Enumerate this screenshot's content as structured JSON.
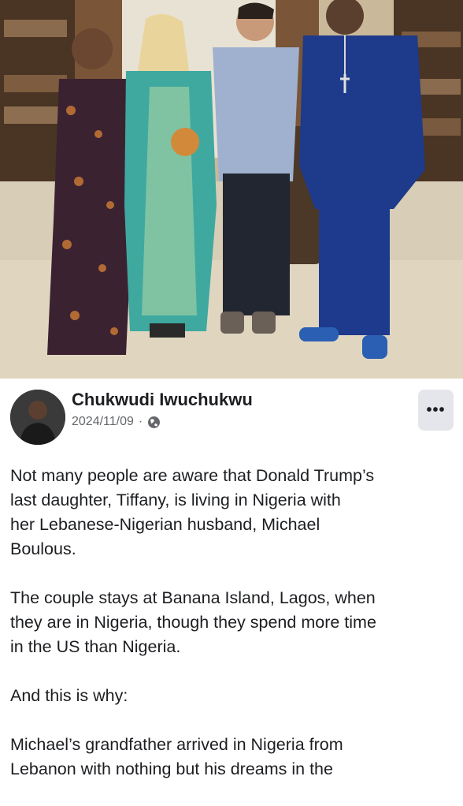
{
  "post": {
    "author": "Chukwudi Iwuchukwu",
    "date": "2024/11/09",
    "separator": "·",
    "privacy_icon": "globe-icon",
    "more_icon": "more-options-icon",
    "more_label": "•••"
  },
  "content": {
    "p1_l1": "Not many people are aware that Donald Trump’s",
    "p1_l2": "last daughter, Tiffany, is living in Nigeria with",
    "p1_l3": "her Lebanese-Nigerian husband, Michael",
    "p1_l4": "Boulous.",
    "p2_l1": "The couple stays at Banana Island, Lagos, when",
    "p2_l2": "they are in Nigeria, though they spend more time",
    "p2_l3": "in the US than Nigeria.",
    "p3_l1": "And this is why:",
    "p4_l1": "Michael’s grandfather arrived in Nigeria from",
    "p4_l2": "Lebanon with nothing but his dreams in the"
  },
  "colors": {
    "text_primary": "#1c1e21",
    "text_secondary": "#65676b",
    "button_bg": "#e4e6eb"
  }
}
